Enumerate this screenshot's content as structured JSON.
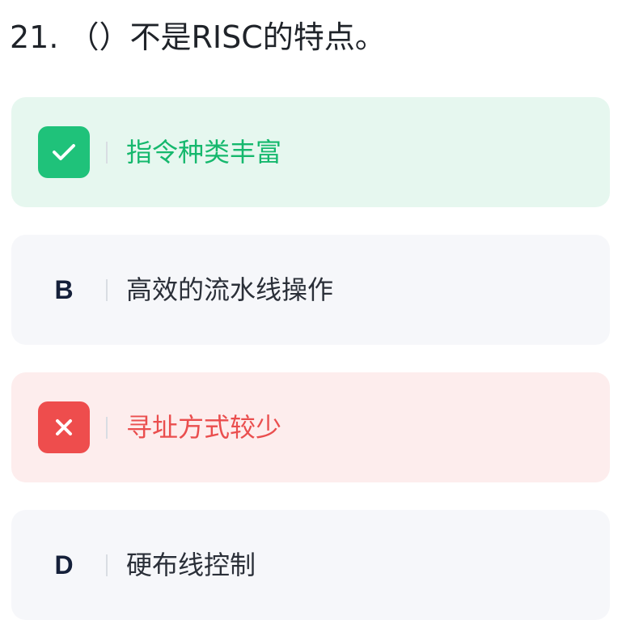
{
  "question": {
    "text": "21. （）不是RISC的特点。"
  },
  "options": [
    {
      "marker": "check",
      "text": "指令种类丰富",
      "state": "correct"
    },
    {
      "marker": "B",
      "text": "高效的流水线操作",
      "state": "neutral"
    },
    {
      "marker": "cross",
      "text": "寻址方式较少",
      "state": "wrong"
    },
    {
      "marker": "D",
      "text": "硬布线控制",
      "state": "neutral"
    }
  ],
  "colors": {
    "correct_bg": "#e6f7ef",
    "correct_accent": "#1fc27a",
    "wrong_bg": "#fdeded",
    "wrong_accent": "#ee4d4d",
    "neutral_bg": "#f6f7fa"
  }
}
